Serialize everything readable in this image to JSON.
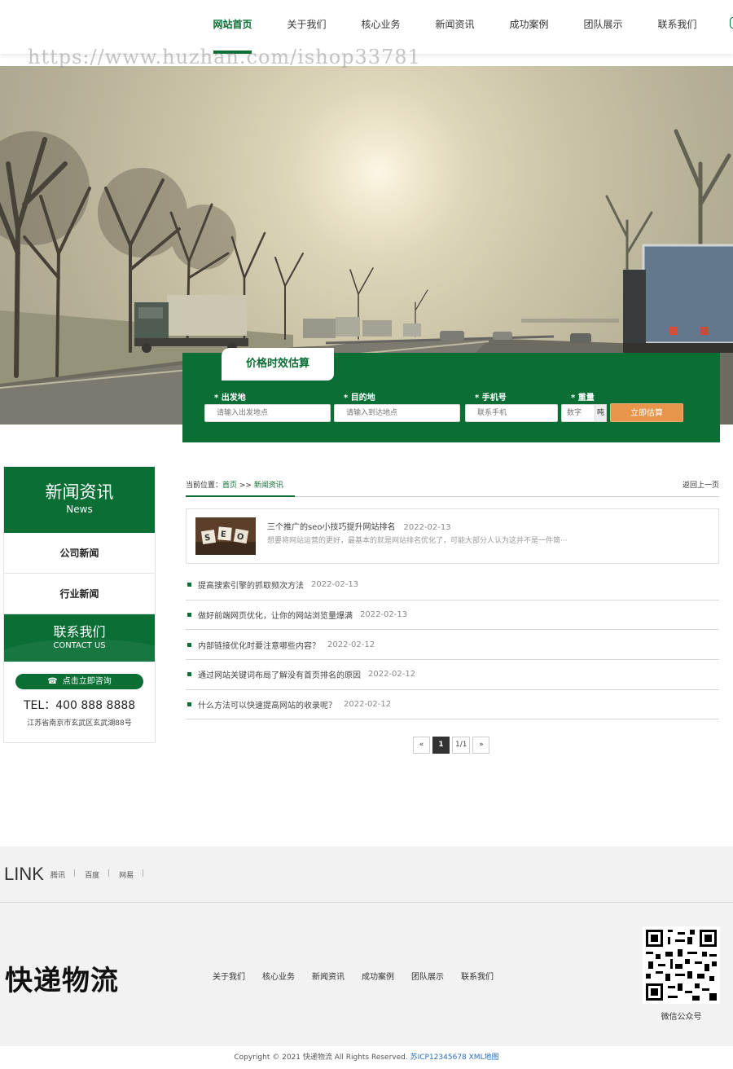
{
  "nav": {
    "items": [
      "网站首页",
      "关于我们",
      "核心业务",
      "新闻资讯",
      "成功案例",
      "团队展示",
      "联系我们"
    ],
    "active_index": 0
  },
  "watermark": "https://www.huzhan.com/ishop33781",
  "estimate": {
    "tab_label": "价格时效估算",
    "origin_label": "* 出发地",
    "origin_placeholder": "请输入出发地点",
    "dest_label": "* 目的地",
    "dest_placeholder": "请输入到达地点",
    "phone_label": "* 手机号",
    "phone_placeholder": "联系手机",
    "weight_label": "* 重量",
    "weight_placeholder": "数字",
    "weight_unit": "吨",
    "submit_label": "立即估算"
  },
  "sidebar": {
    "title": "新闻资讯",
    "subtitle": "News",
    "items": [
      "公司新闻",
      "行业新闻"
    ],
    "contact_title": "联系我们",
    "contact_subtitle": "CONTACT US",
    "consult_label": "点击立即咨询",
    "tel": "TEL：400 888 8888",
    "address": "江苏省南京市玄武区玄武湖88号"
  },
  "breadcrumb": {
    "prefix": "当前位置：",
    "home": "首页",
    "sep": " >> ",
    "current": "新闻资讯",
    "back": "返回上一页"
  },
  "featured": {
    "title": "三个推广的seo小技巧提升网站排名",
    "date": "2022-02-13",
    "desc": "想要将网站运营的更好，最基本的就是网站排名优化了，可能大部分人认为这并不是一件简···"
  },
  "news": [
    {
      "title": "提高搜索引擎的抓取频次方法",
      "date": "2022-02-13"
    },
    {
      "title": "做好前端网页优化，让你的网站浏览量爆满",
      "date": "2022-02-13"
    },
    {
      "title": "内部链接优化时要注意哪些内容？",
      "date": "2022-02-12"
    },
    {
      "title": "通过网站关键词布局了解没有首页排名的原因",
      "date": "2022-02-12"
    },
    {
      "title": "什么方法可以快速提高网站的收录呢？",
      "date": "2022-02-12"
    }
  ],
  "pager": {
    "prev": "«",
    "current": "1",
    "total": "1/1",
    "next": "»"
  },
  "links": {
    "title": "LINK",
    "items": [
      "腾讯",
      "百度",
      "网易"
    ],
    "sep": "|"
  },
  "footer": {
    "logo": "快递物流",
    "nav": [
      "关于我们",
      "核心业务",
      "新闻资讯",
      "成功案例",
      "团队展示",
      "联系我们"
    ],
    "qr_label": "微信公众号"
  },
  "copyright": {
    "text": "Copyright © 2021 快递物流 All Rights Reserved. ",
    "icp": "苏ICP12345678",
    "xml": " XML地图"
  },
  "colors": {
    "brand": "#0a6e35",
    "accent": "#e6954a"
  }
}
